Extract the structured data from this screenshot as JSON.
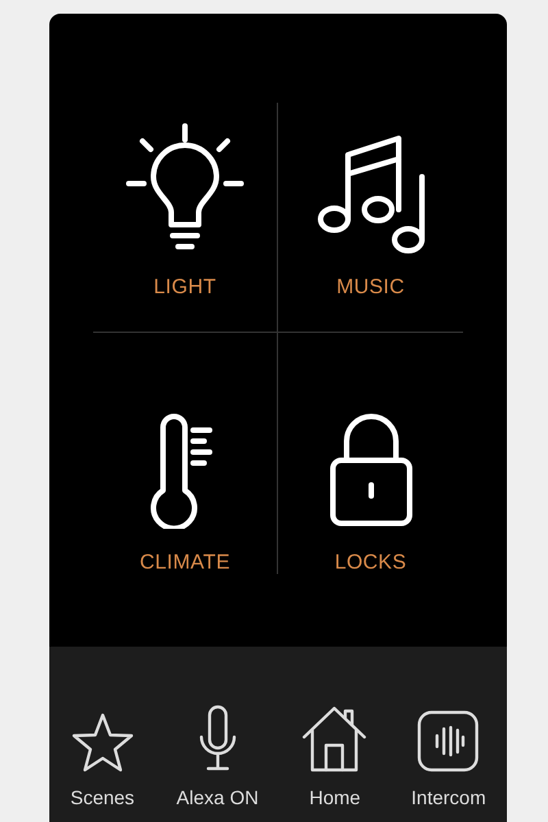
{
  "tiles": [
    {
      "kind": "light",
      "label": "LIGHT"
    },
    {
      "kind": "music",
      "label": "MUSIC"
    },
    {
      "kind": "climate",
      "label": "CLIMATE"
    },
    {
      "kind": "locks",
      "label": "LOCKS"
    }
  ],
  "tab_bar": [
    {
      "kind": "scenes",
      "label": "Scenes"
    },
    {
      "kind": "alexa",
      "label": "Alexa ON"
    },
    {
      "kind": "home",
      "label": "Home"
    },
    {
      "kind": "intercom",
      "label": "Intercom"
    }
  ]
}
